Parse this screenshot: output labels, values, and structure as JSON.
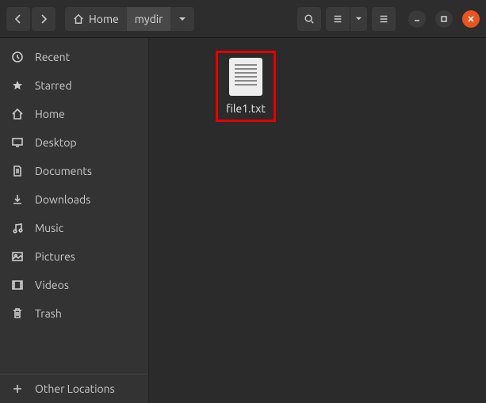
{
  "breadcrumb": {
    "home_label": "Home",
    "current_label": "mydir"
  },
  "sidebar": {
    "items": [
      {
        "label": "Recent",
        "icon": "clock-icon"
      },
      {
        "label": "Starred",
        "icon": "star-icon"
      },
      {
        "label": "Home",
        "icon": "home-icon"
      },
      {
        "label": "Desktop",
        "icon": "desktop-icon"
      },
      {
        "label": "Documents",
        "icon": "documents-icon"
      },
      {
        "label": "Downloads",
        "icon": "downloads-icon"
      },
      {
        "label": "Music",
        "icon": "music-icon"
      },
      {
        "label": "Pictures",
        "icon": "pictures-icon"
      },
      {
        "label": "Videos",
        "icon": "videos-icon"
      },
      {
        "label": "Trash",
        "icon": "trash-icon"
      }
    ],
    "other_locations_label": "Other Locations"
  },
  "files": [
    {
      "name": "file1.txt",
      "type": "text",
      "selected": true
    }
  ],
  "colors": {
    "selection_highlight": "#e30000",
    "close_button": "#e95420"
  }
}
